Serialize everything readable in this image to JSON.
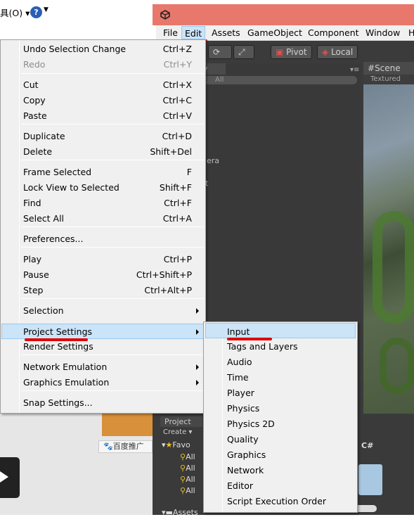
{
  "browser": {
    "menu_text": "具(O) ▾",
    "help_icon": "help-icon"
  },
  "unity": {
    "menubar": [
      "File",
      "Edit",
      "Assets",
      "GameObject",
      "Component",
      "Window",
      "H"
    ],
    "toolbar": {
      "pivot": "Pivot",
      "local": "Local"
    },
    "hierarchy": {
      "tab": "y",
      "search": "All",
      "items": [
        "era",
        "t"
      ]
    },
    "scene": {
      "tab": "Scene",
      "sub": "Textured"
    },
    "project": {
      "tab": "Project",
      "create": "Create ▾",
      "favorites": "Favo",
      "fav_items": [
        "All",
        "All",
        "All",
        "All"
      ],
      "assets": "Assets",
      "cs": "C#"
    }
  },
  "background": {
    "baidu": "百度推广"
  },
  "edit_menu": [
    {
      "label": "Undo Selection Change",
      "shortcut": "Ctrl+Z"
    },
    {
      "label": "Redo",
      "shortcut": "Ctrl+Y",
      "disabled": true
    },
    {
      "label": "Cut",
      "shortcut": "Ctrl+X"
    },
    {
      "label": "Copy",
      "shortcut": "Ctrl+C"
    },
    {
      "label": "Paste",
      "shortcut": "Ctrl+V"
    },
    {
      "label": "Duplicate",
      "shortcut": "Ctrl+D"
    },
    {
      "label": "Delete",
      "shortcut": "Shift+Del"
    },
    {
      "label": "Frame Selected",
      "shortcut": "F"
    },
    {
      "label": "Lock View to Selected",
      "shortcut": "Shift+F"
    },
    {
      "label": "Find",
      "shortcut": "Ctrl+F"
    },
    {
      "label": "Select All",
      "shortcut": "Ctrl+A"
    },
    {
      "label": "Preferences...",
      "shortcut": ""
    },
    {
      "label": "Play",
      "shortcut": "Ctrl+P"
    },
    {
      "label": "Pause",
      "shortcut": "Ctrl+Shift+P"
    },
    {
      "label": "Step",
      "shortcut": "Ctrl+Alt+P"
    },
    {
      "label": "Selection",
      "shortcut": "",
      "submenu": true
    },
    {
      "label": "Project Settings",
      "shortcut": "",
      "submenu": true,
      "highlighted": true
    },
    {
      "label": "Render Settings",
      "shortcut": ""
    },
    {
      "label": "Network Emulation",
      "shortcut": "",
      "submenu": true
    },
    {
      "label": "Graphics Emulation",
      "shortcut": "",
      "submenu": true
    },
    {
      "label": "Snap Settings...",
      "shortcut": ""
    }
  ],
  "project_settings_submenu": [
    "Input",
    "Tags and Layers",
    "Audio",
    "Time",
    "Player",
    "Physics",
    "Physics 2D",
    "Quality",
    "Graphics",
    "Network",
    "Editor",
    "Script Execution Order"
  ]
}
